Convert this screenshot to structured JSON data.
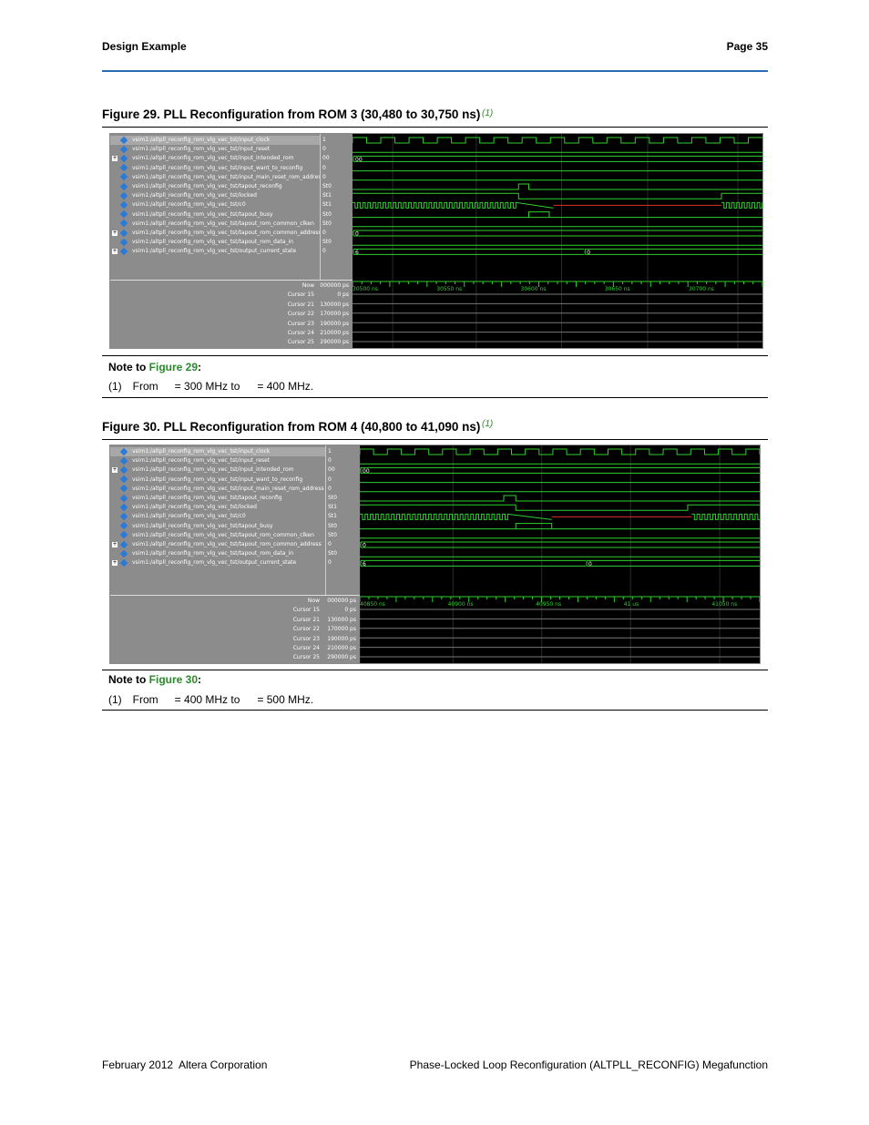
{
  "header": {
    "left": "Design Example",
    "right": "Page 35"
  },
  "figures": [
    {
      "title": "Figure 29.  PLL Reconfiguration from ROM 3 (30,480 to 30,750 ns)",
      "note_ref": "(1)",
      "signals": [
        {
          "name": "vsim1:/altpll_reconfig_rom_vlg_vec_tst/input_clock",
          "value": "1",
          "expand": false
        },
        {
          "name": "vsim1:/altpll_reconfig_rom_vlg_vec_tst/input_reset",
          "value": "0",
          "expand": false
        },
        {
          "name": "vsim1:/altpll_reconfig_rom_vlg_vec_tst/input_intended_rom",
          "value": "00",
          "expand": true
        },
        {
          "name": "vsim1:/altpll_reconfig_rom_vlg_vec_tst/input_want_to_reconfig",
          "value": "0",
          "expand": false
        },
        {
          "name": "vsim1:/altpll_reconfig_rom_vlg_vec_tst/input_main_reset_rom_address",
          "value": "0",
          "expand": false
        },
        {
          "name": "vsim1:/altpll_reconfig_rom_vlg_vec_tst/tapout_reconfig",
          "value": "St0",
          "expand": false
        },
        {
          "name": "vsim1:/altpll_reconfig_rom_vlg_vec_tst/locked",
          "value": "St1",
          "expand": false
        },
        {
          "name": "vsim1:/altpll_reconfig_rom_vlg_vec_tst/c0",
          "value": "St1",
          "expand": false
        },
        {
          "name": "vsim1:/altpll_reconfig_rom_vlg_vec_tst/tapout_busy",
          "value": "St0",
          "expand": false
        },
        {
          "name": "vsim1:/altpll_reconfig_rom_vlg_vec_tst/tapout_rom_common_clken",
          "value": "St0",
          "expand": false
        },
        {
          "name": "vsim1:/altpll_reconfig_rom_vlg_vec_tst/tapout_rom_common_address",
          "value": "0",
          "expand": true
        },
        {
          "name": "vsim1:/altpll_reconfig_rom_vlg_vec_tst/tapout_rom_data_in",
          "value": "St0",
          "expand": false
        },
        {
          "name": "vsim1:/altpll_reconfig_rom_vlg_vec_tst/output_current_state",
          "value": "0",
          "expand": true
        }
      ],
      "bus_labels": {
        "intended_rom": "00",
        "common_address": "0",
        "state_a": "6",
        "state_b": "0"
      },
      "now_label": "Now",
      "now_value": "000000 ps",
      "time_ticks": [
        "30500 ns",
        "30550 ns",
        "30600 ns",
        "30650 ns",
        "30700 ns"
      ],
      "cursors": [
        {
          "name": "Cursor 15",
          "value": "0 ps"
        },
        {
          "name": "Cursor 21",
          "value": "130000 ps"
        },
        {
          "name": "Cursor 22",
          "value": "170000 ps"
        },
        {
          "name": "Cursor 23",
          "value": "190000 ps"
        },
        {
          "name": "Cursor 24",
          "value": "210000 ps"
        },
        {
          "name": "Cursor 25",
          "value": "290000 ps"
        }
      ],
      "note_title": "Note to ",
      "note_title_ref": "Figure 29",
      "note_title_colon": ":",
      "note_num": "(1)",
      "note_text_a": "From",
      "note_text_b": "= 300 MHz to",
      "note_text_c": "= 400 MHz."
    },
    {
      "title": "Figure 30.  PLL Reconfiguration from ROM 4 (40,800 to 41,090 ns)",
      "note_ref": "(1)",
      "signals": [
        {
          "name": "vsim1:/altpll_reconfig_rom_vlg_vec_tst/input_clock",
          "value": "1",
          "expand": false
        },
        {
          "name": "vsim1:/altpll_reconfig_rom_vlg_vec_tst/input_reset",
          "value": "0",
          "expand": false
        },
        {
          "name": "vsim1:/altpll_reconfig_rom_vlg_vec_tst/input_intended_rom",
          "value": "00",
          "expand": true
        },
        {
          "name": "vsim1:/altpll_reconfig_rom_vlg_vec_tst/input_want_to_reconfig",
          "value": "0",
          "expand": false
        },
        {
          "name": "vsim1:/altpll_reconfig_rom_vlg_vec_tst/input_main_reset_rom_address",
          "value": "0",
          "expand": false
        },
        {
          "name": "vsim1:/altpll_reconfig_rom_vlg_vec_tst/tapout_reconfig",
          "value": "St0",
          "expand": false
        },
        {
          "name": "vsim1:/altpll_reconfig_rom_vlg_vec_tst/locked",
          "value": "St1",
          "expand": false
        },
        {
          "name": "vsim1:/altpll_reconfig_rom_vlg_vec_tst/c0",
          "value": "St1",
          "expand": false
        },
        {
          "name": "vsim1:/altpll_reconfig_rom_vlg_vec_tst/tapout_busy",
          "value": "St0",
          "expand": false
        },
        {
          "name": "vsim1:/altpll_reconfig_rom_vlg_vec_tst/tapout_rom_common_clken",
          "value": "St0",
          "expand": false
        },
        {
          "name": "vsim1:/altpll_reconfig_rom_vlg_vec_tst/tapout_rom_common_address",
          "value": "0",
          "expand": true
        },
        {
          "name": "vsim1:/altpll_reconfig_rom_vlg_vec_tst/tapout_rom_data_in",
          "value": "St0",
          "expand": false
        },
        {
          "name": "vsim1:/altpll_reconfig_rom_vlg_vec_tst/output_current_state",
          "value": "0",
          "expand": true
        }
      ],
      "bus_labels": {
        "intended_rom": "00",
        "common_address": "0",
        "state_a": "6",
        "state_b": "0"
      },
      "now_label": "Now",
      "now_value": "000000 ps",
      "time_ticks": [
        "40850 ns",
        "40900 ns",
        "40950 ns",
        "41 us",
        "41050 ns"
      ],
      "cursors": [
        {
          "name": "Cursor 15",
          "value": "0 ps"
        },
        {
          "name": "Cursor 21",
          "value": "130000 ps"
        },
        {
          "name": "Cursor 22",
          "value": "170000 ps"
        },
        {
          "name": "Cursor 23",
          "value": "190000 ps"
        },
        {
          "name": "Cursor 24",
          "value": "210000 ps"
        },
        {
          "name": "Cursor 25",
          "value": "290000 ps"
        }
      ],
      "note_title": "Note to ",
      "note_title_ref": "Figure 30",
      "note_title_colon": ":",
      "note_num": "(1)",
      "note_text_a": "From",
      "note_text_b": "= 400 MHz to",
      "note_text_c": "= 500 MHz."
    }
  ],
  "footer": {
    "date": "February 2012",
    "company": "Altera Corporation",
    "doc": "Phase-Locked Loop Reconfiguration (ALTPLL_RECONFIG) Megafunction"
  },
  "colors": {
    "accent": "#2a6db5",
    "link": "#2a8a2a",
    "wave_green": "#2fcf2f",
    "wave_red": "#e0302a"
  }
}
